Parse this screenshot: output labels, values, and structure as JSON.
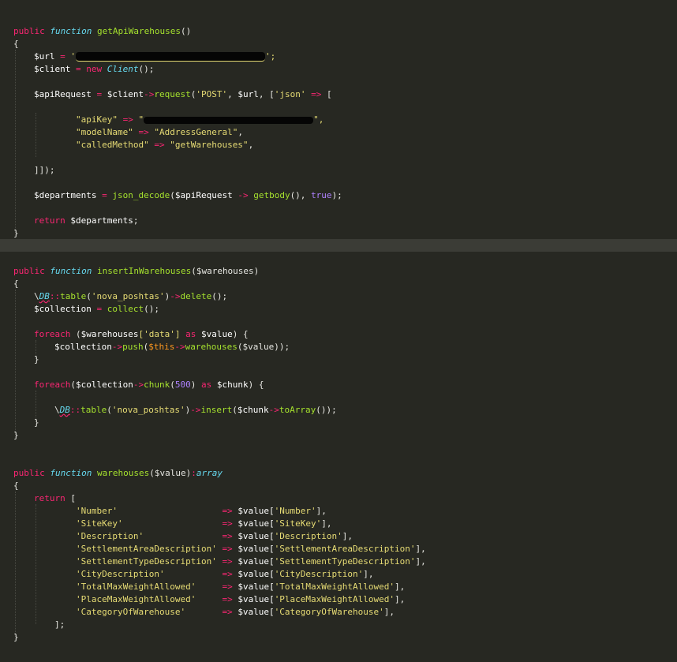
{
  "functions": [
    {
      "signature": {
        "kw": "public",
        "fn": "function",
        "name": "getApiWarehouses",
        "params": "()"
      },
      "open": "{",
      "url_var": "$url",
      "eq1": "=",
      "url_open": "'",
      "url_close": "';",
      "client_var": "$client",
      "eq2": "=",
      "new_kw": "new",
      "client_cls": "Client",
      "client_end": "();",
      "api_var": "$apiRequest",
      "eq3": "=",
      "api_obj": "$client",
      "arrow1": "->",
      "request_fn": "request",
      "req_p1": "(",
      "req_post": "'POST'",
      "req_comma": ",",
      "req_url": "$url",
      "req_comma2": ",",
      "req_b": "[",
      "req_json": "'json'",
      "req_arrow": "=>",
      "req_open": "[",
      "apikey_key": "\"apiKey\"",
      "apikey_arrow": "=>",
      "apikey_open": "\"",
      "apikey_close": "\",",
      "model_key": "\"modelName\"",
      "model_arrow": "=>",
      "model_val": "\"AddressGeneral\"",
      "model_comma": ",",
      "called_key": "\"calledMethod\"",
      "called_arrow": "=>",
      "called_val": "\"getWarehouses\"",
      "called_comma": ",",
      "close_req": "]]);",
      "dep_var": "$departments",
      "eq4": "=",
      "json_fn": "json_decode",
      "json_p": "(",
      "json_arg": "$apiRequest",
      "json_arrow": "->",
      "getbody": "getbody",
      "json_mid": "(),",
      "true_kw": "true",
      "json_end": ");",
      "ret_kw": "return",
      "ret_var": "$departments",
      "ret_end": ";",
      "close": "}"
    },
    {
      "signature": {
        "kw": "public",
        "fn": "function",
        "name": "insertInWarehouses",
        "params": "($warehouses)"
      },
      "open": "{",
      "db_slash": "\\",
      "db": "DB",
      "db_colons": "::",
      "table_fn": "table",
      "table_p": "(",
      "table_arg": "'nova_poshtas'",
      "table_pe": ")",
      "arrow_del": "->",
      "delete_fn": "delete",
      "del_end": "();",
      "coll_var": "$collection",
      "eq": "=",
      "collect_fn": "collect",
      "collect_end": "();",
      "foreach_kw": "foreach",
      "fe_open": " (",
      "fe_var": "$warehouses",
      "fe_idx": "['data']",
      "fe_as": "as",
      "fe_val": "$value",
      "fe_close": ") {",
      "push_var": "$collection",
      "push_arrow": "->",
      "push_fn": "push",
      "push_p": "(",
      "push_this": "$this",
      "push_arrow2": "->",
      "push_wh": "warehouses",
      "push_arg": "($value));",
      "fe_end": "}",
      "foreach2_kw": "foreach",
      "fe2_p": "(",
      "fe2_var": "$collection",
      "fe2_arrow": "->",
      "chunk_fn": "chunk",
      "chunk_p": "(",
      "chunk_num": "500",
      "chunk_pe": ")",
      "fe2_as": "as",
      "fe2_chunk": "$chunk",
      "fe2_close": ") {",
      "ins_slash": "\\",
      "ins_db": "DB",
      "ins_colons": "::",
      "ins_table": "table",
      "ins_tp": "(",
      "ins_targ": "'nova_poshtas'",
      "ins_tpe": ")",
      "ins_arrow": "->",
      "insert_fn": "insert",
      "ins_p": "(",
      "ins_chunk": "$chunk",
      "ins_arrow2": "->",
      "toarray_fn": "toArray",
      "ins_end": "());",
      "fe2_end": "}",
      "close": "}"
    },
    {
      "signature": {
        "kw": "public",
        "fn": "function",
        "name": "warehouses",
        "params": "($value)",
        "colon": ":",
        "ret_type": "array"
      },
      "open": "{",
      "ret_kw": "return",
      "ret_open": "[",
      "rows": [
        {
          "key": "'Number'",
          "pad": "                    ",
          "arrow": "=>",
          "var": "$value[",
          "idx": "'Number'",
          "end": "],"
        },
        {
          "key": "'SiteKey'",
          "pad": "                   ",
          "arrow": "=>",
          "var": "$value[",
          "idx": "'SiteKey'",
          "end": "],"
        },
        {
          "key": "'Description'",
          "pad": "               ",
          "arrow": "=>",
          "var": "$value[",
          "idx": "'Description'",
          "end": "],"
        },
        {
          "key": "'SettlementAreaDescription'",
          "pad": " ",
          "arrow": "=>",
          "var": "$value[",
          "idx": "'SettlementAreaDescription'",
          "end": "],"
        },
        {
          "key": "'SettlementTypeDescription'",
          "pad": " ",
          "arrow": "=>",
          "var": "$value[",
          "idx": "'SettlementTypeDescription'",
          "end": "],"
        },
        {
          "key": "'CityDescription'",
          "pad": "           ",
          "arrow": "=>",
          "var": "$value[",
          "idx": "'CityDescription'",
          "end": "],"
        },
        {
          "key": "'TotalMaxWeightAllowed'",
          "pad": "     ",
          "arrow": "=>",
          "var": "$value[",
          "idx": "'TotalMaxWeightAllowed'",
          "end": "],"
        },
        {
          "key": "'PlaceMaxWeightAllowed'",
          "pad": "     ",
          "arrow": "=>",
          "var": "$value[",
          "idx": "'PlaceMaxWeightAllowed'",
          "end": "],"
        },
        {
          "key": "'CategoryOfWarehouse'",
          "pad": "       ",
          "arrow": "=>",
          "var": "$value[",
          "idx": "'CategoryOfWarehouse'",
          "end": "],"
        }
      ],
      "ret_close": "];",
      "close": "}"
    }
  ],
  "colors": {
    "background": "#272822",
    "keyword": "#f92672",
    "function_keyword": "#66d9ef",
    "function_name": "#a6e22e",
    "string": "#e6db74",
    "number": "#ae81ff",
    "this": "#fd971f",
    "highlight_band": "#3b3c36"
  }
}
